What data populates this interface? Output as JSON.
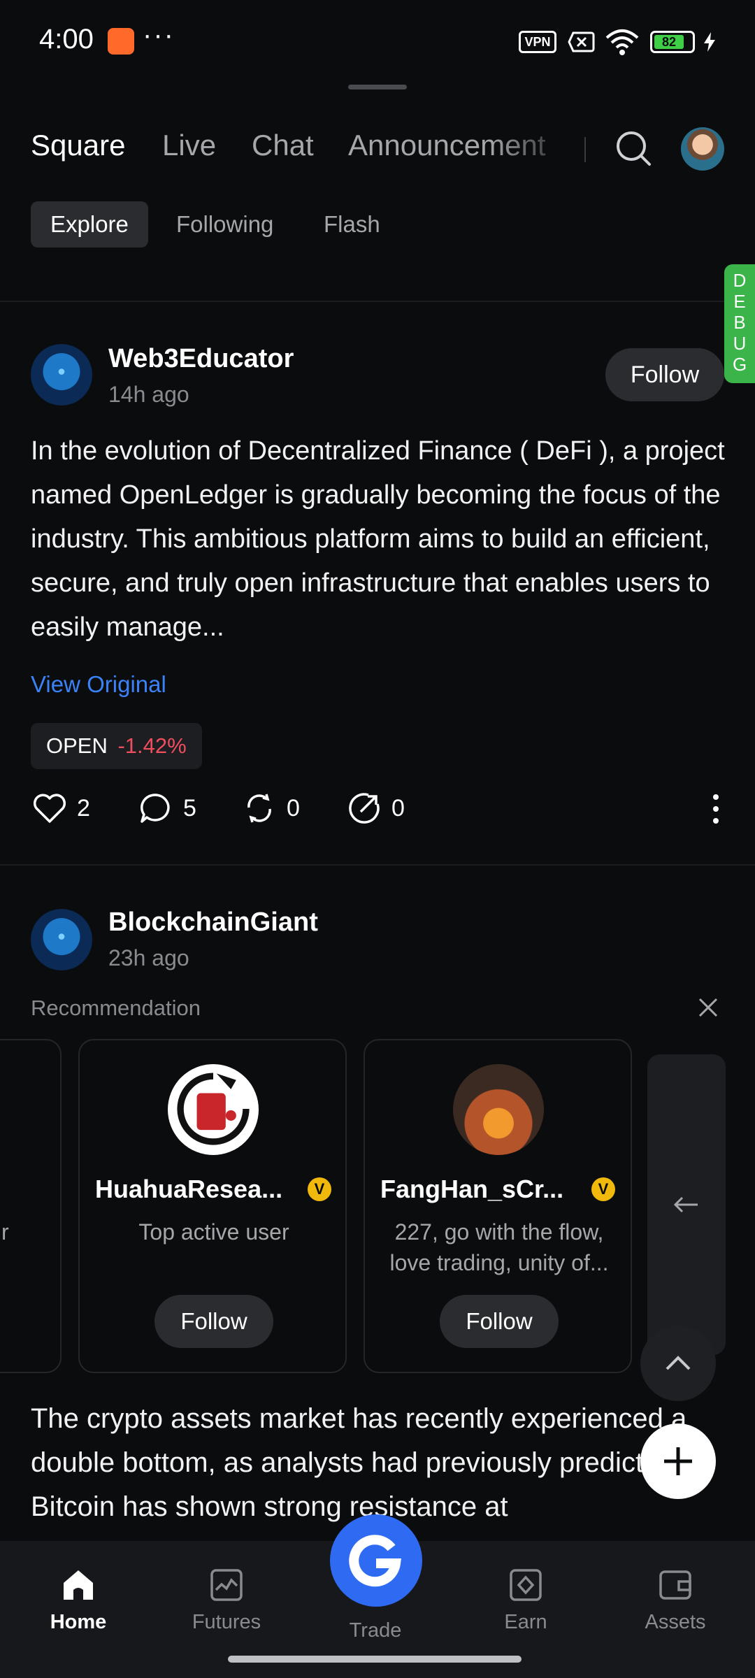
{
  "status_bar": {
    "time": "4:00",
    "dots": "···",
    "vpn": "VPN",
    "battery": "82"
  },
  "header": {
    "tabs": [
      {
        "label": "Square",
        "active": true
      },
      {
        "label": "Live"
      },
      {
        "label": "Chat"
      },
      {
        "label": "Announcement"
      }
    ]
  },
  "subtabs": [
    {
      "label": "Explore",
      "active": true
    },
    {
      "label": "Following"
    },
    {
      "label": "Flash"
    }
  ],
  "debug_label": "DEBUG",
  "post1": {
    "author": "Web3Educator",
    "time": "14h ago",
    "follow_label": "Follow",
    "body": "In the evolution of Decentralized Finance ( DeFi ), a project named OpenLedger is gradually becoming the focus of the industry. This ambitious platform aims to build an efficient, secure, and truly open infrastructure that enables users to easily manage...",
    "view_original": "View Original",
    "ticker": {
      "name": "OPEN",
      "change": "-1.42%"
    },
    "likes": "2",
    "comments": "5",
    "reposts": "0",
    "shares": "0"
  },
  "post2": {
    "author": "BlockchainGiant",
    "time": "23h ago",
    "recommendation_label": "Recommendation",
    "partial_card_text": "r",
    "cards": [
      {
        "name": "HuahuaResea...",
        "desc": "Top active user",
        "follow": "Follow"
      },
      {
        "name": "FangHan_sCr...",
        "desc": "227, go with the flow, love trading, unity of...",
        "follow": "Follow"
      }
    ],
    "body": "The crypto assets market has recently experienced a double bottom, as analysts had previously predicted. Bitcoin has shown strong resistance at"
  },
  "bottom_nav": [
    {
      "label": "Home",
      "active": true
    },
    {
      "label": "Futures"
    },
    {
      "label": "Trade"
    },
    {
      "label": "Earn"
    },
    {
      "label": "Assets"
    }
  ],
  "colors": {
    "background": "#0b0c0e",
    "accent_blue": "#2f6bf2",
    "link_blue": "#3b82f6",
    "negative_red": "#f04d5e",
    "verified_gold": "#f0b90b",
    "debug_green": "#3bb54a"
  }
}
